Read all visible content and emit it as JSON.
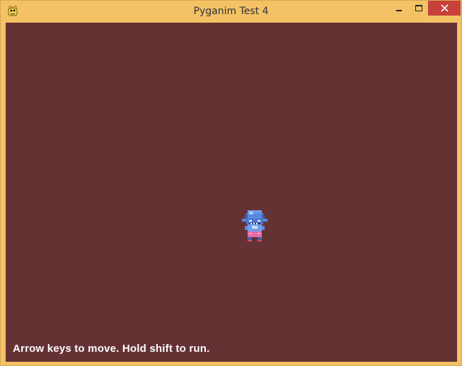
{
  "window": {
    "title": "Pyganim Test 4",
    "icon": "pygame-snake-icon",
    "controls": {
      "minimize_icon": "minimize-icon",
      "maximize_icon": "maximize-icon",
      "close_icon": "close-icon"
    }
  },
  "game": {
    "background_color": "#653234",
    "sprite": "blue-goblin-character",
    "hint_text": "Arrow keys to move. Hold shift to run."
  },
  "colors": {
    "frame": "#f2c265",
    "close_button": "#c7413b"
  }
}
